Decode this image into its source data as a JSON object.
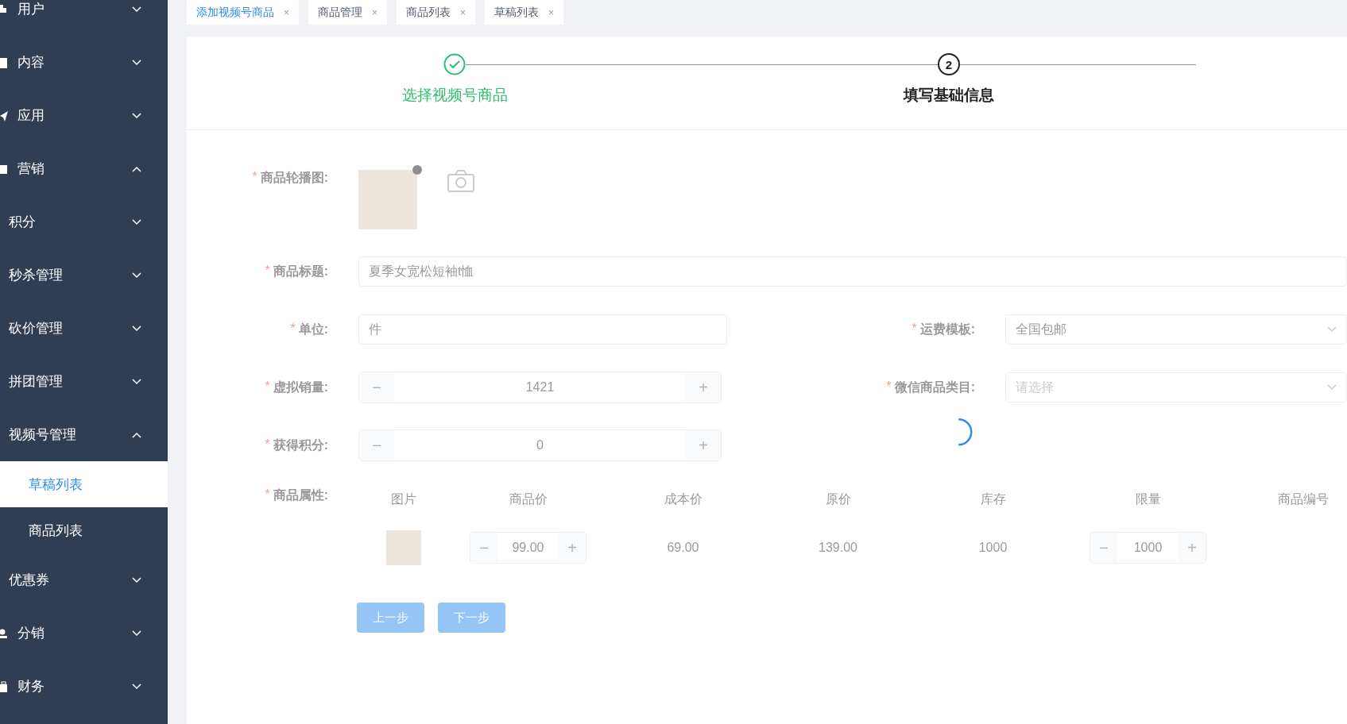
{
  "sidebar": {
    "items": [
      {
        "label": "用户",
        "kind": "menu",
        "expanded": false
      },
      {
        "label": "内容",
        "kind": "menu",
        "expanded": false
      },
      {
        "label": "应用",
        "kind": "menu",
        "expanded": false
      },
      {
        "label": "营销",
        "kind": "menu",
        "expanded": true
      },
      {
        "label": "积分",
        "kind": "submenu",
        "expanded": false
      },
      {
        "label": "秒杀管理",
        "kind": "submenu",
        "expanded": false
      },
      {
        "label": "砍价管理",
        "kind": "submenu",
        "expanded": false
      },
      {
        "label": "拼团管理",
        "kind": "submenu",
        "expanded": false
      },
      {
        "label": "视频号管理",
        "kind": "submenu",
        "expanded": true,
        "children": [
          {
            "label": "草稿列表",
            "selected": true
          },
          {
            "label": "商品列表",
            "selected": false
          }
        ]
      },
      {
        "label": "优惠券",
        "kind": "submenu",
        "expanded": false
      },
      {
        "label": "分销",
        "kind": "menu",
        "expanded": false
      },
      {
        "label": "财务",
        "kind": "menu",
        "expanded": false
      }
    ]
  },
  "tabs": [
    {
      "label": "添加视频号商品",
      "close": "×",
      "selected": true
    },
    {
      "label": "商品管理",
      "close": "×",
      "selected": false
    },
    {
      "label": "商品列表",
      "close": "×",
      "selected": false
    },
    {
      "label": "草稿列表",
      "close": "×",
      "selected": false
    }
  ],
  "steps": [
    {
      "label": "选择视频号商品",
      "done": true
    },
    {
      "label": "填写基础信息",
      "number": "2",
      "done": false
    }
  ],
  "loading": true,
  "form": {
    "rows": [
      {
        "kind": "upload",
        "mark": "*",
        "label": "商品轮播图:"
      },
      {
        "kind": "input",
        "mark": "*",
        "label": "商品标题:",
        "value": "夏季女宽松短袖t恤"
      },
      {
        "kind": "pair",
        "fields": [
          {
            "kind": "input",
            "mark": "*",
            "label": "单位:",
            "value": "件"
          },
          {
            "kind": "select",
            "mark": "*",
            "label": "运费模板:",
            "value": "全国包邮"
          }
        ]
      },
      {
        "kind": "pair",
        "fields": [
          {
            "kind": "number",
            "mark": "*",
            "label": "虚拟销量:",
            "value": "1421",
            "minus": "−",
            "plus": "+"
          },
          {
            "kind": "select",
            "mark": "*",
            "label": "微信商品类目:",
            "placeholder": "请选择"
          }
        ]
      },
      {
        "kind": "number",
        "mark": "*",
        "label": "获得积分:",
        "value": "0",
        "minus": "−",
        "plus": "+"
      },
      {
        "kind": "table",
        "mark": "*",
        "label": "商品属性:"
      }
    ]
  },
  "table": {
    "columns": [
      "图片",
      "商品价",
      "成本价",
      "原价",
      "库存",
      "限量",
      "商品编号"
    ],
    "rows": [
      {
        "price": "99.00",
        "cost": "69.00",
        "original": "139.00",
        "stock": "1000",
        "limit": "1000",
        "minus": "−",
        "plus": "+"
      }
    ]
  },
  "buttons": [
    {
      "label": "上一步"
    },
    {
      "label": "下一步"
    }
  ]
}
